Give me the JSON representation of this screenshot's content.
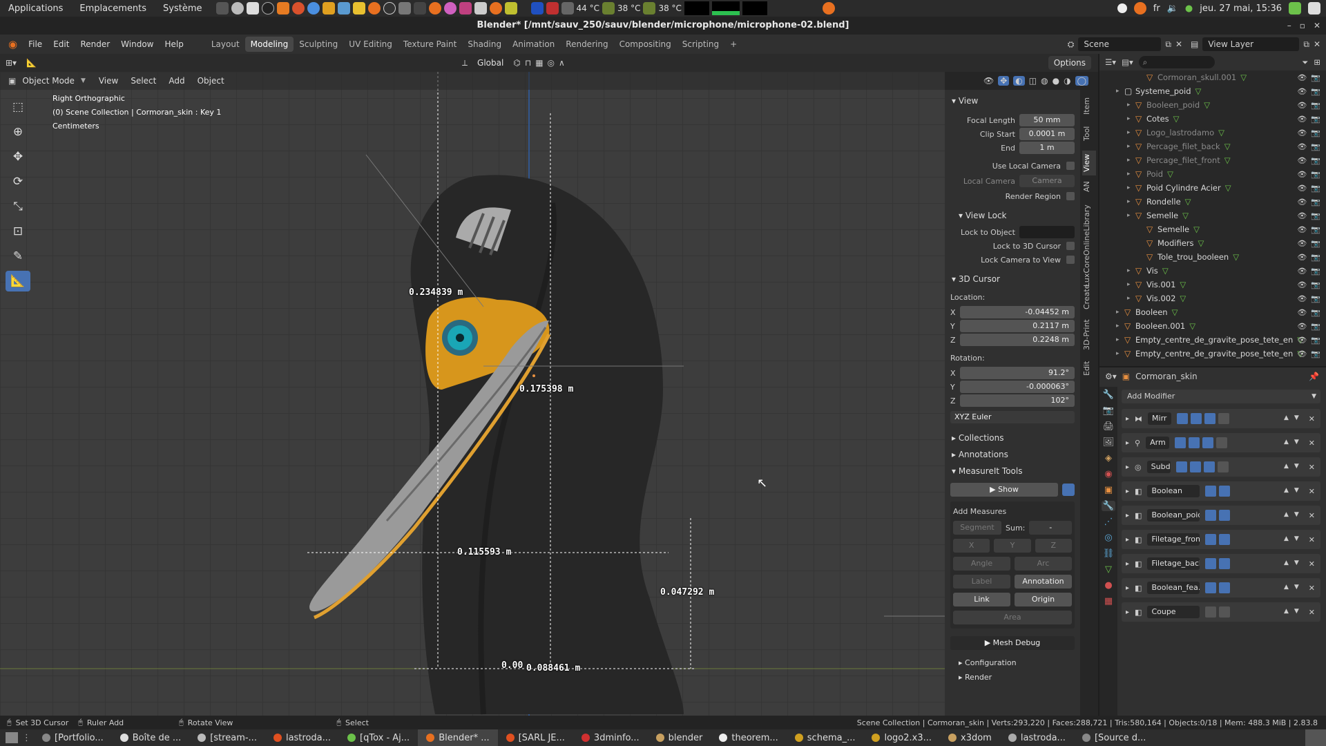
{
  "system": {
    "menus": [
      "Applications",
      "Emplacements",
      "Système"
    ],
    "temps": [
      "44 °C",
      "38 °C",
      "38 °C"
    ],
    "lang": "fr",
    "datetime": "jeu. 27 mai, 15:36"
  },
  "window": {
    "title": "Blender* [/mnt/sauv_250/sauv/blender/microphone/microphone-02.blend]"
  },
  "topbar": {
    "menus": [
      "File",
      "Edit",
      "Render",
      "Window",
      "Help"
    ],
    "workspaces": [
      "Layout",
      "Modeling",
      "Sculpting",
      "UV Editing",
      "Texture Paint",
      "Shading",
      "Animation",
      "Rendering",
      "Compositing",
      "Scripting"
    ],
    "active_workspace": "Modeling",
    "add_tab": "+",
    "scene_label": "Scene",
    "view_layer_label": "View Layer"
  },
  "viewport_header": {
    "transform_orientation": "Global",
    "options_label": "Options",
    "mode": "Object Mode",
    "menus": [
      "View",
      "Select",
      "Add",
      "Object"
    ]
  },
  "viewport_overlay": {
    "view_name": "Right Orthographic",
    "collection_info": "(0) Scene Collection | Cormoran_skin : Key 1",
    "units": "Centimeters"
  },
  "measurements": [
    "0.234839 m",
    "0.175398 m",
    "0.115593 m",
    "0.047292 m",
    "0.00",
    "0.088461 m"
  ],
  "npanel": {
    "view_header": "View",
    "focal_length_label": "Focal Length",
    "focal_length": "50 mm",
    "clip_start_label": "Clip Start",
    "clip_start": "0.0001 m",
    "end_label": "End",
    "end": "1 m",
    "use_local_camera": "Use Local Camera",
    "local_camera_label": "Local Camera",
    "local_camera": "Camera",
    "render_region": "Render Region",
    "view_lock_header": "View Lock",
    "lock_to_object": "Lock to Object",
    "lock_to_3d_cursor": "Lock to 3D Cursor",
    "lock_camera_to_view": "Lock Camera to View",
    "cursor_header": "3D Cursor",
    "location_label": "Location:",
    "loc_x": "-0.04452 m",
    "loc_y": "0.2117 m",
    "loc_z": "0.2248 m",
    "rotation_label": "Rotation:",
    "rot_x": "91.2°",
    "rot_y": "-0.000063°",
    "rot_z": "102°",
    "rotation_mode": "XYZ Euler",
    "collections": "Collections",
    "annotations": "Annotations",
    "measureit": "MeasureIt Tools",
    "show": "Show",
    "add_measures": "Add Measures",
    "segment": "Segment",
    "sum_label": "Sum:",
    "sum_value": "-",
    "x": "X",
    "y": "Y",
    "z": "Z",
    "angle": "Angle",
    "arc": "Arc",
    "label": "Label",
    "annotation": "Annotation",
    "link": "Link",
    "origin": "Origin",
    "area": "Area",
    "mesh_debug": "Mesh Debug",
    "configuration": "Configuration",
    "render": "Render"
  },
  "side_tabs": [
    "Item",
    "Tool",
    "View",
    "AN",
    "LuxCoreOnlineLibrary",
    "Create",
    "3D-Print",
    "Edit"
  ],
  "outliner": {
    "rows": [
      {
        "name": "Cormoran_skull.001",
        "dim": true,
        "indent": 3
      },
      {
        "name": "Systeme_poid",
        "dim": false,
        "indent": 1
      },
      {
        "name": "Booleen_poid",
        "dim": true,
        "indent": 2
      },
      {
        "name": "Cotes",
        "dim": false,
        "indent": 2
      },
      {
        "name": "Logo_lastrodamo",
        "dim": true,
        "indent": 2
      },
      {
        "name": "Percage_filet_back",
        "dim": true,
        "indent": 2
      },
      {
        "name": "Percage_filet_front",
        "dim": true,
        "indent": 2
      },
      {
        "name": "Poid",
        "dim": true,
        "indent": 2
      },
      {
        "name": "Poid Cylindre Acier",
        "dim": false,
        "indent": 2
      },
      {
        "name": "Rondelle",
        "dim": false,
        "indent": 2
      },
      {
        "name": "Semelle",
        "dim": false,
        "indent": 2
      },
      {
        "name": "Semelle",
        "dim": false,
        "indent": 3
      },
      {
        "name": "Modifiers",
        "dim": false,
        "indent": 3
      },
      {
        "name": "Tole_trou_booleen",
        "dim": false,
        "indent": 3
      },
      {
        "name": "Vis",
        "dim": false,
        "indent": 2
      },
      {
        "name": "Vis.001",
        "dim": false,
        "indent": 2
      },
      {
        "name": "Vis.002",
        "dim": false,
        "indent": 2
      },
      {
        "name": "Booleen",
        "dim": false,
        "indent": 1
      },
      {
        "name": "Booleen.001",
        "dim": false,
        "indent": 1
      },
      {
        "name": "Empty_centre_de_gravite_pose_tete_en",
        "dim": false,
        "indent": 1
      },
      {
        "name": "Empty_centre_de_gravite_pose_tete_en",
        "dim": false,
        "indent": 1
      }
    ]
  },
  "properties": {
    "object_name": "Cormoran_skin",
    "add_modifier": "Add Modifier",
    "modifiers": [
      "Mirr",
      "Arm",
      "Subd",
      "Boolean",
      "Boolean_poid",
      "Filetage_front",
      "Filetage_back",
      "Boolean_fea...",
      "Coupe"
    ]
  },
  "status": {
    "set_cursor": "Set 3D Cursor",
    "ruler_add": "Ruler Add",
    "rotate_view": "Rotate View",
    "select": "Select",
    "stats": "Scene Collection | Cormoran_skin | Verts:293,220 | Faces:288,721 | Tris:580,164 | Objects:0/18 | Mem: 488.3 MiB | 2.83.8"
  },
  "taskbar": [
    "[Portfolio...",
    "Boîte de ...",
    "[stream-...",
    "lastroda...",
    "[qTox - Aj...",
    "Blender* ...",
    "[SARL JE...",
    "3dminfo...",
    "blender",
    "theorem...",
    "schema_...",
    "logo2.x3...",
    "x3dom",
    "lastroda...",
    "[Source d..."
  ],
  "taskbar_active": "Blender* ..."
}
